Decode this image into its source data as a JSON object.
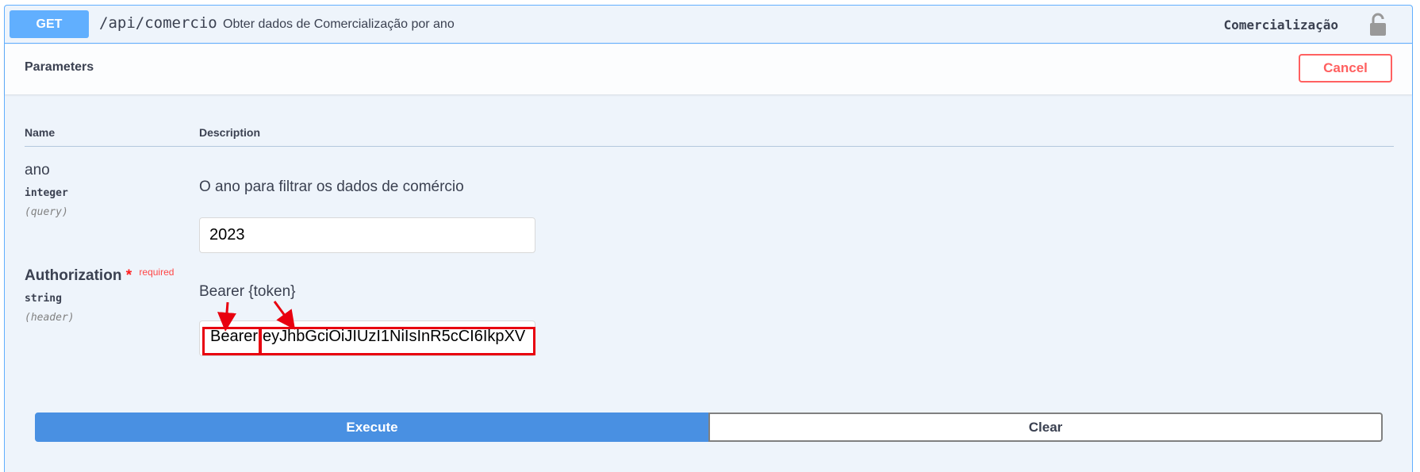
{
  "operation": {
    "method": "GET",
    "path": "/api/comercio",
    "summary": "Obter dados de Comercialização por ano",
    "tag": "Comercialização",
    "lock_icon": "unlocked-padlock-icon"
  },
  "parameters": {
    "title": "Parameters",
    "cancel_label": "Cancel",
    "columns": {
      "name": "Name",
      "description": "Description"
    },
    "items": [
      {
        "name": "ano",
        "type": "integer",
        "in": "(query)",
        "description": "O ano para filtrar os dados de comércio",
        "value": "2023"
      },
      {
        "name": "Authorization",
        "required_marker": "*",
        "required_label": "required",
        "type": "string",
        "in": "(header)",
        "description": "Bearer {token}",
        "value_prefix": "Bearer",
        "value_token": "eyJhbGciOiJIUzI1NiIsInR5cCI6IkpXV"
      }
    ]
  },
  "actions": {
    "execute_label": "Execute",
    "clear_label": "Clear"
  },
  "colors": {
    "method_blue": "#61affe",
    "execute_blue": "#4990e2",
    "cancel_red": "#ff6060",
    "annotation_red": "#e8000f"
  }
}
